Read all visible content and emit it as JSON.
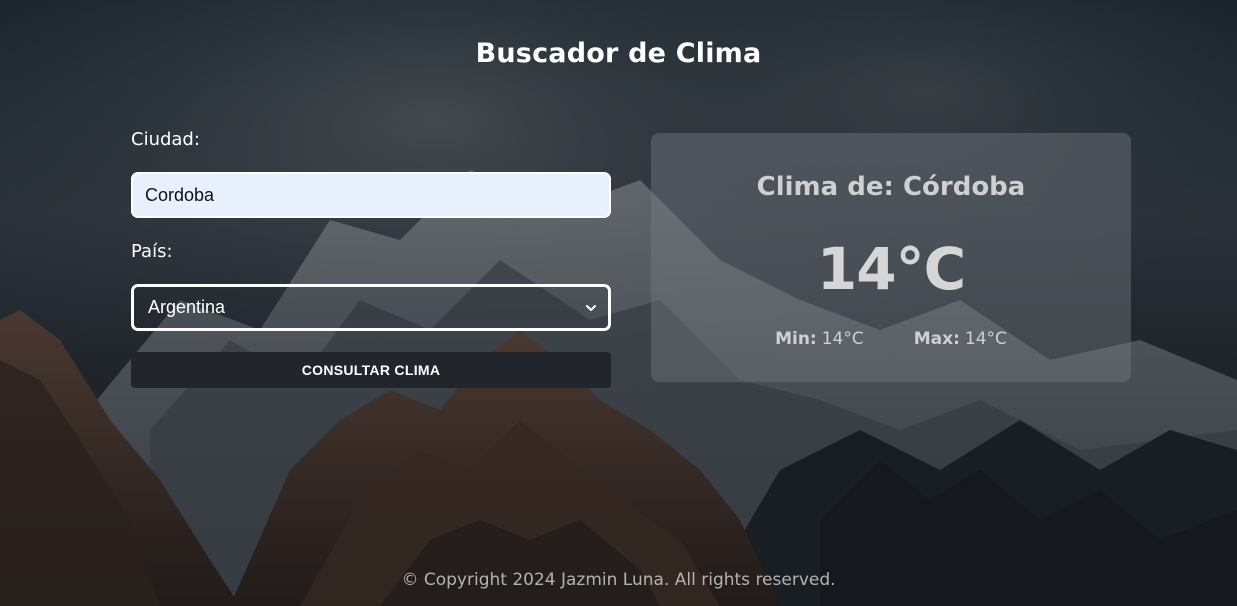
{
  "page": {
    "title": "Buscador de Clima"
  },
  "form": {
    "city_label": "Ciudad:",
    "city_value": "Cordoba",
    "country_label": "País:",
    "country_selected": "Argentina",
    "submit_label": "CONSULTAR CLIMA"
  },
  "result": {
    "title": "Clima de: Córdoba",
    "temperature": "14°C",
    "min_label": "Min:",
    "min_value": "14°C",
    "max_label": "Max:",
    "max_value": "14°C"
  },
  "footer": {
    "copyright": "© Copyright 2024 Jazmin Luna. All rights reserved."
  },
  "colors": {
    "button_bg": "#22252c",
    "input_bg": "#e8f0fe",
    "card_bg": "rgba(120,124,130,0.42)"
  },
  "icons": {
    "select_arrow": "chevron-down-icon"
  }
}
